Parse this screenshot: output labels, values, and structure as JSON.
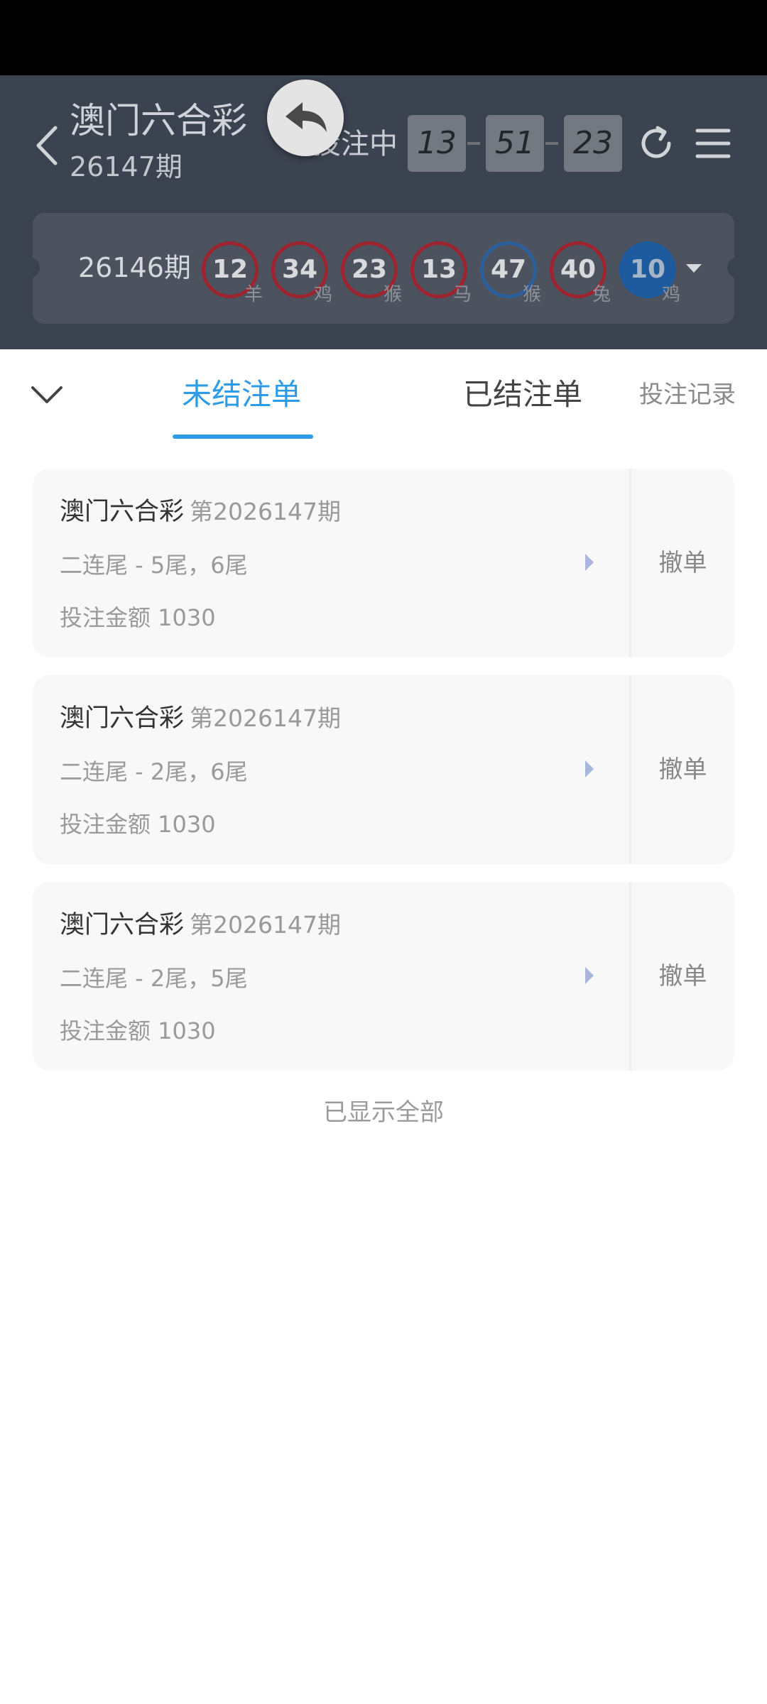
{
  "header": {
    "title": "澳门六合彩",
    "current_period": "26147期",
    "betting_status": "投注中",
    "countdown": [
      "13",
      "51",
      "23"
    ]
  },
  "last_result": {
    "period": "26146期",
    "balls": [
      {
        "number": "12",
        "zodiac": "羊",
        "color": "red"
      },
      {
        "number": "34",
        "zodiac": "鸡",
        "color": "red"
      },
      {
        "number": "23",
        "zodiac": "猴",
        "color": "red"
      },
      {
        "number": "13",
        "zodiac": "马",
        "color": "red"
      },
      {
        "number": "47",
        "zodiac": "猴",
        "color": "blue"
      },
      {
        "number": "40",
        "zodiac": "兔",
        "color": "red"
      },
      {
        "number": "10",
        "zodiac": "鸡",
        "color": "blue"
      }
    ]
  },
  "tabs": {
    "unsettled": "未结注单",
    "settled": "已结注单",
    "history": "投注记录"
  },
  "orders": [
    {
      "game": "澳门六合彩",
      "period": "第2026147期",
      "detail": "二连尾 - 5尾，6尾",
      "amount": "投注金额 1030",
      "cancel": "撤单"
    },
    {
      "game": "澳门六合彩",
      "period": "第2026147期",
      "detail": "二连尾 - 2尾，6尾",
      "amount": "投注金额 1030",
      "cancel": "撤单"
    },
    {
      "game": "澳门六合彩",
      "period": "第2026147期",
      "detail": "二连尾 - 2尾，5尾",
      "amount": "投注金额 1030",
      "cancel": "撤单"
    }
  ],
  "footer": {
    "all_shown": "已显示全部"
  },
  "colors": {
    "accent": "#2d9ce8",
    "red_ball": "#9e2430",
    "blue_ball": "#1d5b9e"
  }
}
